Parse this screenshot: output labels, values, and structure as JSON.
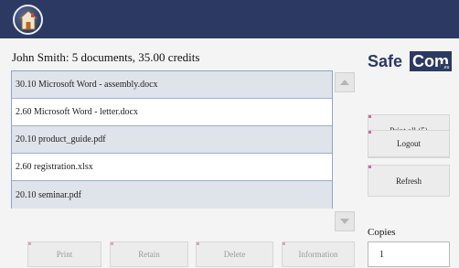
{
  "header": {
    "home_icon": "home-icon",
    "accent_color": "#2c3a63"
  },
  "summary": "John Smith: 5 documents, 35.00 credits",
  "documents": [
    "30.10 Microsoft Word - assembly.docx",
    "2.60 Microsoft Word - letter.docx",
    "20.10 product_guide.pdf",
    "2.60 registration.xlsx",
    "20.10 seminar.pdf"
  ],
  "bottom_buttons": {
    "print": "Print",
    "retain": "Retain",
    "delete": "Delete",
    "information": "Information"
  },
  "logo": {
    "safe": "Safe",
    "com": "Com",
    "eu": ".eu"
  },
  "side_buttons": {
    "print_all": "Print all (5)",
    "logout": "Logout",
    "refresh": "Refresh"
  },
  "copies": {
    "label": "Copies",
    "value": "1"
  }
}
